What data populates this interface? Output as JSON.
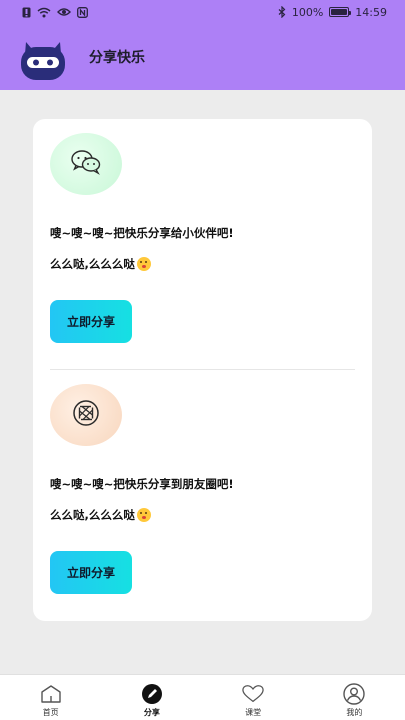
{
  "status_bar": {
    "battery": "100%",
    "time": "14:59"
  },
  "header": {
    "title": "分享快乐"
  },
  "share_items": [
    {
      "icon": "wechat-icon",
      "line1": "嗖~嗖~嗖~把快乐分享给小伙伴吧!",
      "line2": "么么哒,么么么哒",
      "button": "立即分享"
    },
    {
      "icon": "moments-icon",
      "line1": "嗖~嗖~嗖~把快乐分享到朋友圈吧!",
      "line2": "么么哒,么么么哒",
      "button": "立即分享"
    }
  ],
  "tabs": [
    {
      "label": "首页",
      "icon": "home-icon"
    },
    {
      "label": "分享",
      "icon": "share-pen-icon",
      "active": true
    },
    {
      "label": "课堂",
      "icon": "heart-icon"
    },
    {
      "label": "我的",
      "icon": "user-icon"
    }
  ],
  "colors": {
    "header_bg": "#ad80f6",
    "page_bg": "#ececec",
    "button_gradient_start": "#23c6f4",
    "button_gradient_end": "#16e0e2"
  }
}
